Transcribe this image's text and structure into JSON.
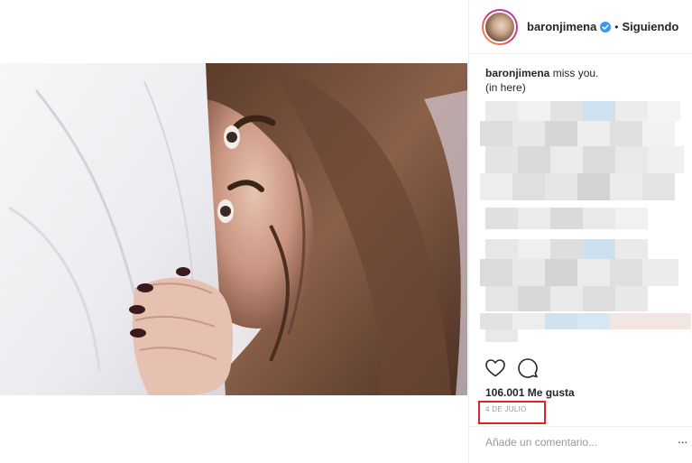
{
  "post": {
    "username": "baronjimena",
    "follow_status": "Siguiendo",
    "separator": "•",
    "caption_user": "baronjimena",
    "caption_text": "miss you.",
    "caption_line2": "(in here)",
    "likes": "106.001 Me gusta",
    "date": "4 DE JULIO",
    "comment_placeholder": "Añade un comentario...",
    "more_glyph": "..."
  },
  "icons": {
    "verified": "verified-badge-icon",
    "like": "heart-icon",
    "comment": "speech-bubble-icon"
  },
  "colors": {
    "verified_blue": "#3897f0",
    "highlight_red": "#e0232b",
    "muted_text": "#999999",
    "divider": "#efefef"
  }
}
